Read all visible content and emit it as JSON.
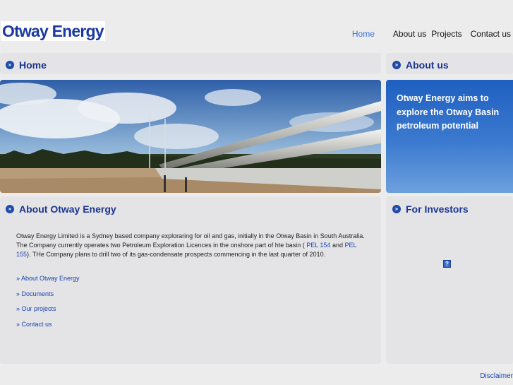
{
  "header": {
    "logo": "Otway Energy",
    "nav": [
      "Home",
      "About us",
      "Projects",
      "Contact us"
    ]
  },
  "home": {
    "title": "Home"
  },
  "about_us": {
    "title": "About us",
    "tagline": "Otway Energy aims to explore the Otway Basin petroleum potential"
  },
  "about_energy": {
    "title": "About Otway Energy",
    "text_1": "Otway Energy Limited is a Sydney based company exploraring for oil and gas, initially in the Otway Basin in South Australia. The Company currently operates two Petroleum Exploration Licences in the onshore part of hte basin (",
    "link_1": "PEL 154",
    "text_2": " and ",
    "link_2": "PEL 155",
    "text_3": "). THe Company plans to drill two of its gas-condensate prospects commencing in the last quarter of 2010.",
    "links": [
      "» About Otway Energy",
      "» Documents",
      "» Our projects",
      "» Contact us"
    ]
  },
  "investors": {
    "title": "For Investors",
    "icon": "?"
  },
  "footer": {
    "disclaimer": "Disclaimer"
  },
  "colors": {
    "brand": "#1a3aa0",
    "accent": "#3a6fd8"
  },
  "icons": {
    "panel_bullet": "chevron-right-circle-icon",
    "broken_image": "question-icon"
  }
}
